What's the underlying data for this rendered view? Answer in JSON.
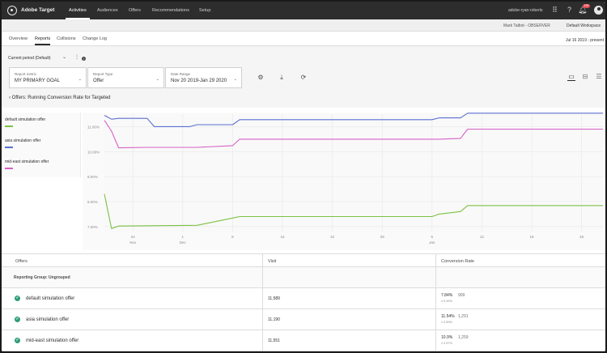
{
  "app": {
    "name": "Adobe Target"
  },
  "topnav": {
    "items": [
      "Activities",
      "Audiences",
      "Offers",
      "Recommendations",
      "Setup"
    ],
    "active": "Activities",
    "user": "adobe-ryan-roberts",
    "notification_count": "199"
  },
  "workspace_bar": {
    "observer": "Mark Talbot - OBSERVER",
    "workspace": "Default Workspace"
  },
  "subtabs": {
    "items": [
      "Overview",
      "Reports",
      "Collisions",
      "Change Log"
    ],
    "active": "Reports",
    "date_range": "Jul 16 2019 - present"
  },
  "controls": {
    "period": "Current period (Default)",
    "report_metric_label": "Report metric",
    "report_metric_value": "MY PRIMARY GOAL",
    "report_type_label": "Report Type",
    "report_type_value": "Offer",
    "date_range_label": "Date Range",
    "date_range_value": "Nov 20 2019-Jan 29 2020",
    "breadcrumb": "Offers: Running Conversion Rate for Targeted"
  },
  "legend": [
    {
      "name": "default simulation offer",
      "color": "#7bc142"
    },
    {
      "name": "asia simulation offer",
      "color": "#5a6fd1"
    },
    {
      "name": "mid-east simulation offer",
      "color": "#d561c6"
    }
  ],
  "chart_data": {
    "type": "line",
    "y_ticks": [
      "11.00%",
      "10.00%",
      "9.00%",
      "8.00%",
      "7.00%"
    ],
    "x_ticks": [
      {
        "day": "24",
        "month": "Nov"
      },
      {
        "day": "1",
        "month": "Dec"
      },
      {
        "day": "8",
        "month": ""
      },
      {
        "day": "15",
        "month": ""
      },
      {
        "day": "22",
        "month": ""
      },
      {
        "day": "29",
        "month": ""
      },
      {
        "day": "5",
        "month": "Jan"
      },
      {
        "day": "12",
        "month": ""
      },
      {
        "day": "19",
        "month": ""
      },
      {
        "day": "26",
        "month": ""
      }
    ],
    "ylim": [
      6.8,
      11.5
    ],
    "xlim": [
      "2019-11-20",
      "2020-01-29"
    ],
    "grid": true,
    "series": [
      {
        "name": "asia simulation offer",
        "color": "#5a6fd1",
        "x": [
          "2019-11-20",
          "2019-11-21",
          "2019-11-22",
          "2019-11-24",
          "2019-11-26",
          "2019-11-27",
          "2019-12-02",
          "2019-12-03",
          "2019-12-08",
          "2019-12-09",
          "2020-01-05",
          "2020-01-06",
          "2020-01-09",
          "2020-01-10",
          "2020-01-29"
        ],
        "values": [
          11.45,
          11.3,
          11.33,
          11.33,
          11.33,
          11.0,
          11.0,
          11.08,
          11.08,
          11.28,
          11.28,
          11.35,
          11.35,
          11.54,
          11.54
        ]
      },
      {
        "name": "mid-east simulation offer",
        "color": "#d561c6",
        "x": [
          "2019-11-20",
          "2019-11-21",
          "2019-11-22",
          "2019-11-26",
          "2019-12-03",
          "2019-12-08",
          "2019-12-09",
          "2020-01-05",
          "2020-01-06",
          "2020-01-09",
          "2020-01-10",
          "2020-01-29"
        ],
        "values": [
          11.25,
          10.82,
          10.15,
          10.17,
          10.17,
          10.24,
          10.5,
          10.5,
          10.5,
          10.53,
          10.9,
          10.9
        ]
      },
      {
        "name": "default simulation offer",
        "color": "#7bc142",
        "x": [
          "2019-11-20",
          "2019-11-21",
          "2019-11-22",
          "2019-12-03",
          "2019-12-08",
          "2019-12-09",
          "2020-01-05",
          "2020-01-06",
          "2020-01-09",
          "2020-01-10",
          "2020-01-29"
        ],
        "values": [
          8.3,
          6.92,
          7.02,
          7.05,
          7.34,
          7.4,
          7.4,
          7.5,
          7.6,
          7.84,
          7.84
        ]
      }
    ]
  },
  "table": {
    "columns": [
      "Offers",
      "Visit",
      "Conversion Rate"
    ],
    "group_label": "Reporting Group: Ungrouped",
    "rows": [
      {
        "name": "default simulation offer",
        "visit": "11,589",
        "rate": "7.84%",
        "conversions": "909",
        "ci": "± 0.49%"
      },
      {
        "name": "asia simulation offer",
        "visit": "11,190",
        "rate": "11.54%",
        "conversions": "1,291",
        "ci": "± 0.59%"
      },
      {
        "name": "mid-east simulation offer",
        "visit": "11,551",
        "rate": "10.9%",
        "conversions": "1,259",
        "ci": "± 0.57%"
      }
    ]
  }
}
